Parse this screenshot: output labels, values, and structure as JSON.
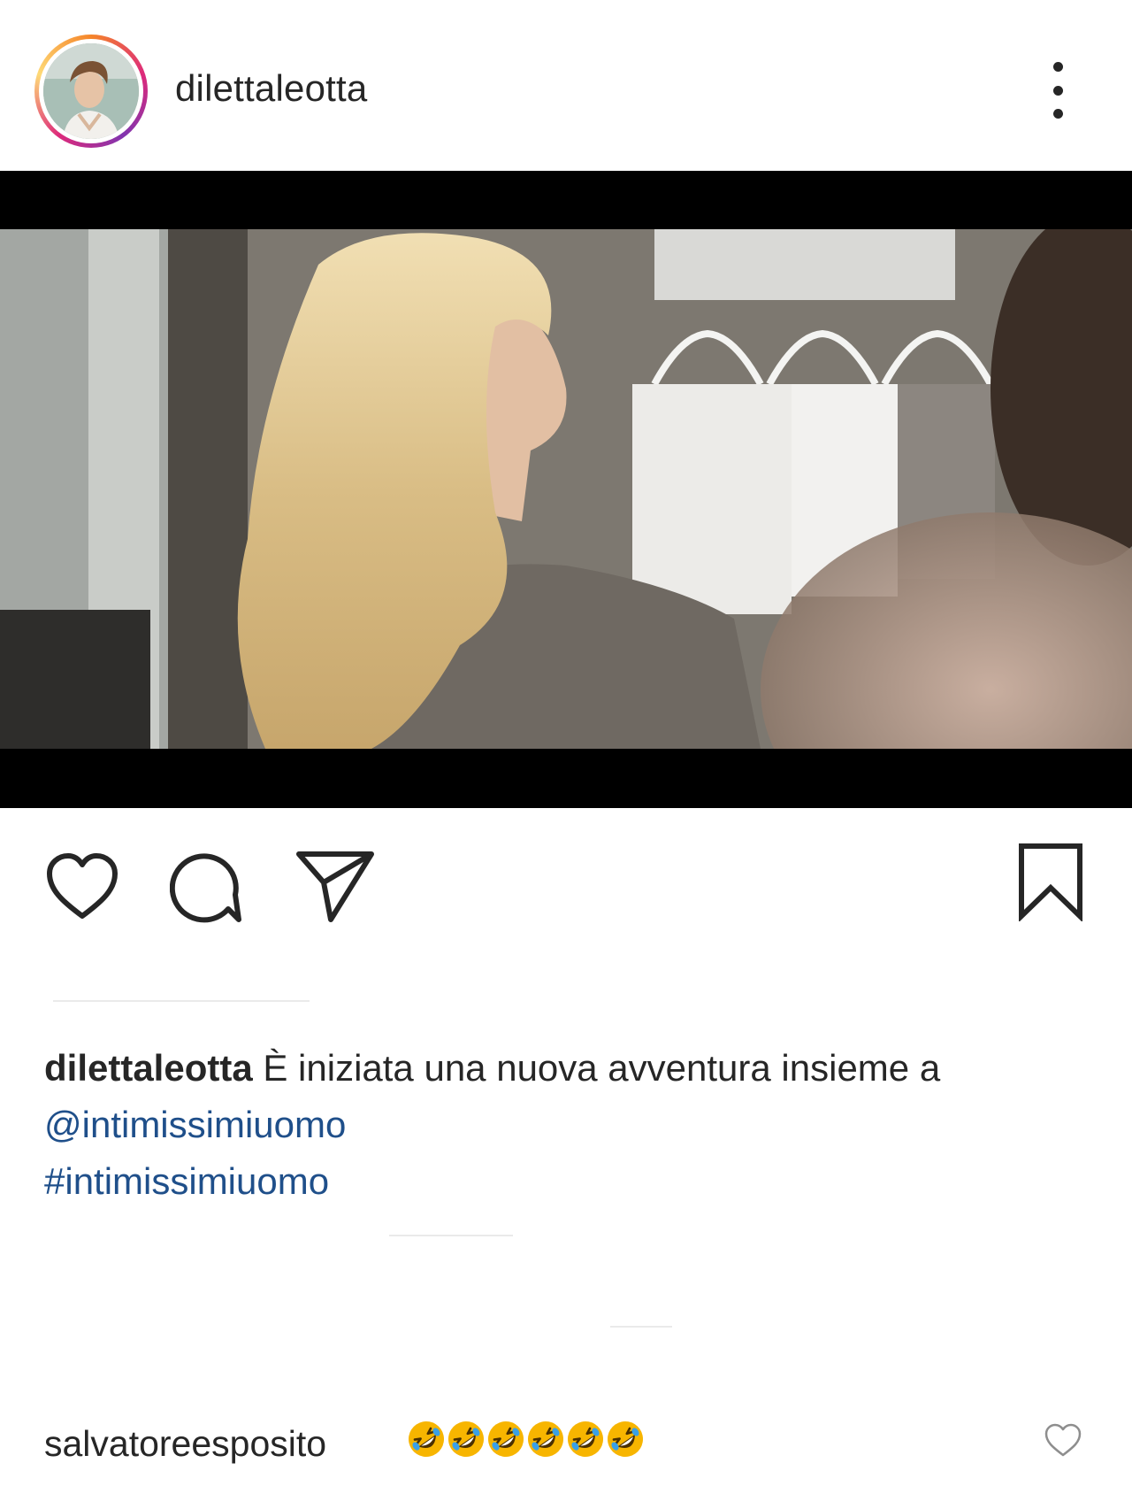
{
  "header": {
    "username": "dilettaleotta",
    "avatar_icon": "profile-photo",
    "more_icon": "more-options-icon"
  },
  "media": {
    "type": "video",
    "description_icon": "video-frame"
  },
  "actions": {
    "like_icon": "heart-icon",
    "comment_icon": "comment-icon",
    "share_icon": "paper-plane-icon",
    "save_icon": "bookmark-icon"
  },
  "caption": {
    "username": "dilettaleotta",
    "text": "È iniziata una nuova avventura insieme a",
    "mention": "@intimissimiuomo",
    "hashtag": "#intimissimiuomo"
  },
  "comment": {
    "username": "salvatoreesposito",
    "emoji_count": 6,
    "emoji_icon": "rolling-on-floor-laughing-emoji",
    "like_icon": "heart-outline-icon"
  },
  "colors": {
    "text": "#262626",
    "link": "#1f4f8a",
    "story_ring": "#dd2a7b",
    "emoji_yellow": "#f7b500"
  }
}
